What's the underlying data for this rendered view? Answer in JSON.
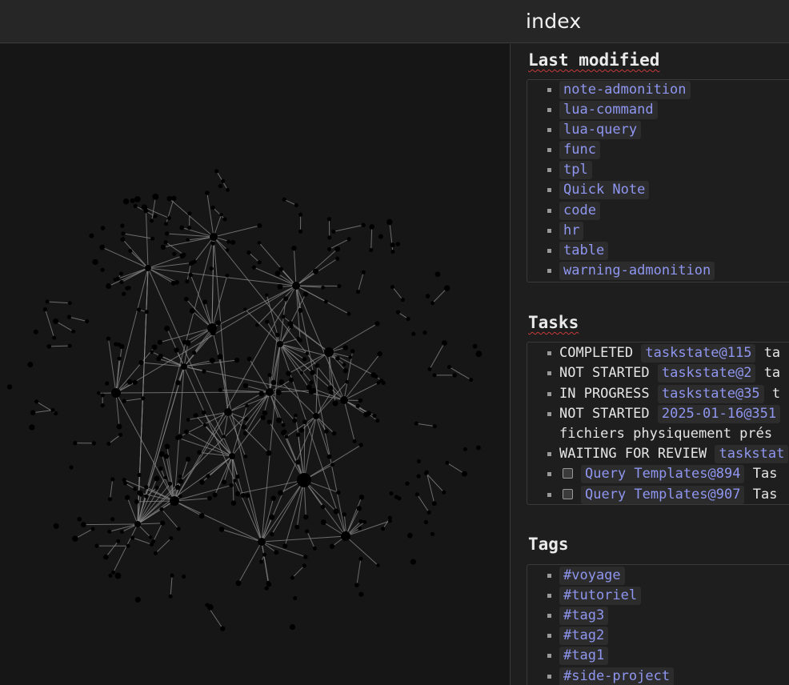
{
  "page": {
    "title": "index"
  },
  "sections": {
    "last_modified": {
      "title": "Last modified",
      "items": [
        "note-admonition",
        "lua-command",
        "lua-query",
        "func",
        "tpl",
        "Quick Note",
        "code",
        "hr",
        "table",
        "warning-admonition"
      ]
    },
    "tasks": {
      "title": "Tasks",
      "items": [
        {
          "state": "COMPLETED",
          "link": "taskstate@115",
          "after": "ta"
        },
        {
          "state": "NOT STARTED",
          "link": "taskstate@2",
          "after": "ta"
        },
        {
          "state": "IN PROGRESS",
          "link": "taskstate@35",
          "after": "t"
        },
        {
          "state": "NOT STARTED",
          "link": "2025-01-16@351",
          "after": ""
        },
        {
          "state": "WAITING FOR REVIEW",
          "link": "taskstat",
          "after": ""
        },
        {
          "state": "",
          "link": "Query Templates@894",
          "after": "Tas"
        },
        {
          "state": "",
          "link": "Query Templates@907",
          "after": "Tas"
        }
      ],
      "continuation": "fichiers  physiquement prés"
    },
    "tags": {
      "title": "Tags",
      "items": [
        "#voyage",
        "#tutoriel",
        "#tag3",
        "#tag2",
        "#tag1",
        "#side-project"
      ]
    }
  },
  "colors": {
    "link": "#8f96f0",
    "background": "#1e1e1e",
    "graph_background": "#161616",
    "spellcheck": "#c43a3a"
  },
  "icons": {
    "checkbox": "checkbox-icon",
    "bullet": "bullet-icon"
  }
}
